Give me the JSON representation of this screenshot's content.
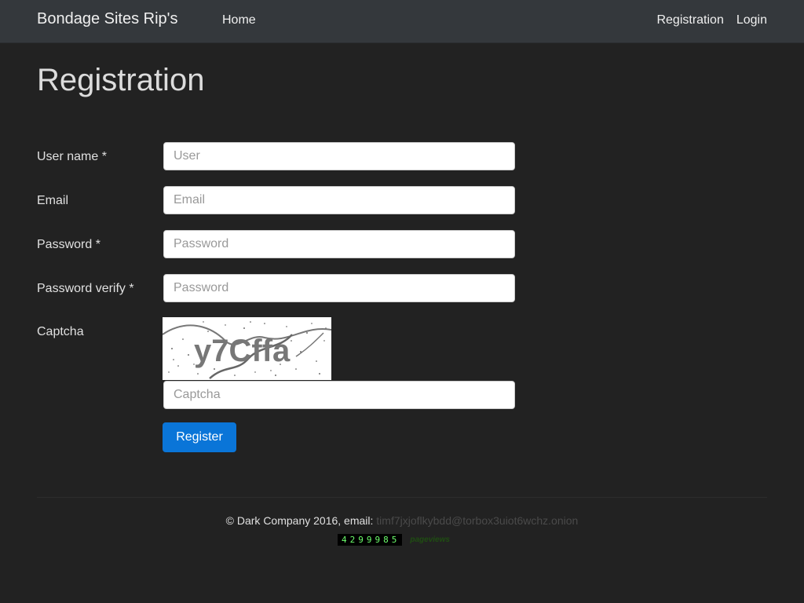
{
  "navbar": {
    "brand": "Bondage Sites Rip's",
    "home": "Home",
    "registration": "Registration",
    "login": "Login"
  },
  "page": {
    "title": "Registration"
  },
  "form": {
    "username": {
      "label": "User name *",
      "placeholder": "User",
      "value": ""
    },
    "email": {
      "label": "Email",
      "placeholder": "Email",
      "value": ""
    },
    "password": {
      "label": "Password *",
      "placeholder": "Password",
      "value": ""
    },
    "password_verify": {
      "label": "Password verify *",
      "placeholder": "Password",
      "value": ""
    },
    "captcha": {
      "label": "Captcha",
      "image_text": "y7Cffa",
      "placeholder": "Captcha",
      "value": ""
    },
    "submit_label": "Register"
  },
  "footer": {
    "copyright": "© Dark Company 2016, email: ",
    "email": "timf7jxjoflkybdd@torbox3uiot6wchz.onion",
    "counter": "4299985",
    "pageviews_label": "pageviews"
  },
  "colors": {
    "background": "#222222",
    "navbar": "#34383c",
    "primary_button": "#0a75d8"
  }
}
